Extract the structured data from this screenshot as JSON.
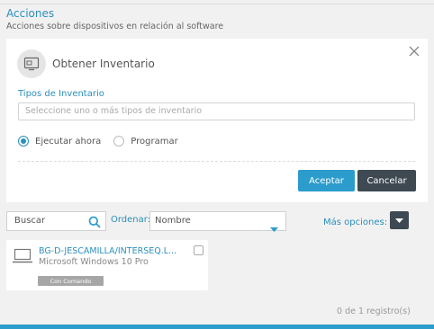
{
  "header": {
    "title": "Acciones",
    "subtitle": "Acciones sobre dispositivos en relación al software"
  },
  "panel": {
    "icon": "inventory-icon",
    "title": "Obtener Inventario",
    "field_label": "Tipos de Inventario",
    "input_placeholder": "Seleccione uno o más tipos de inventario",
    "radio_now": "Ejecutar ahora",
    "radio_schedule": "Programar",
    "selected_radio": "now",
    "accept_label": "Aceptar",
    "cancel_label": "Cancelar"
  },
  "toolbar": {
    "search_placeholder": "Buscar",
    "order_label": "Ordenar:",
    "order_value": "Nombre",
    "more_options_label": "Más opciones:"
  },
  "devices": [
    {
      "name": "BG-D-JESCAMILLA/INTERSEQ.L...",
      "os": "Microsoft Windows 10 Pro",
      "badge": "Con Comando",
      "checked": false
    }
  ],
  "pagination": {
    "count_text": "0 de 1 registro(s)"
  },
  "colors": {
    "accent": "#2b9ccc",
    "dark_button": "#3e4952"
  }
}
